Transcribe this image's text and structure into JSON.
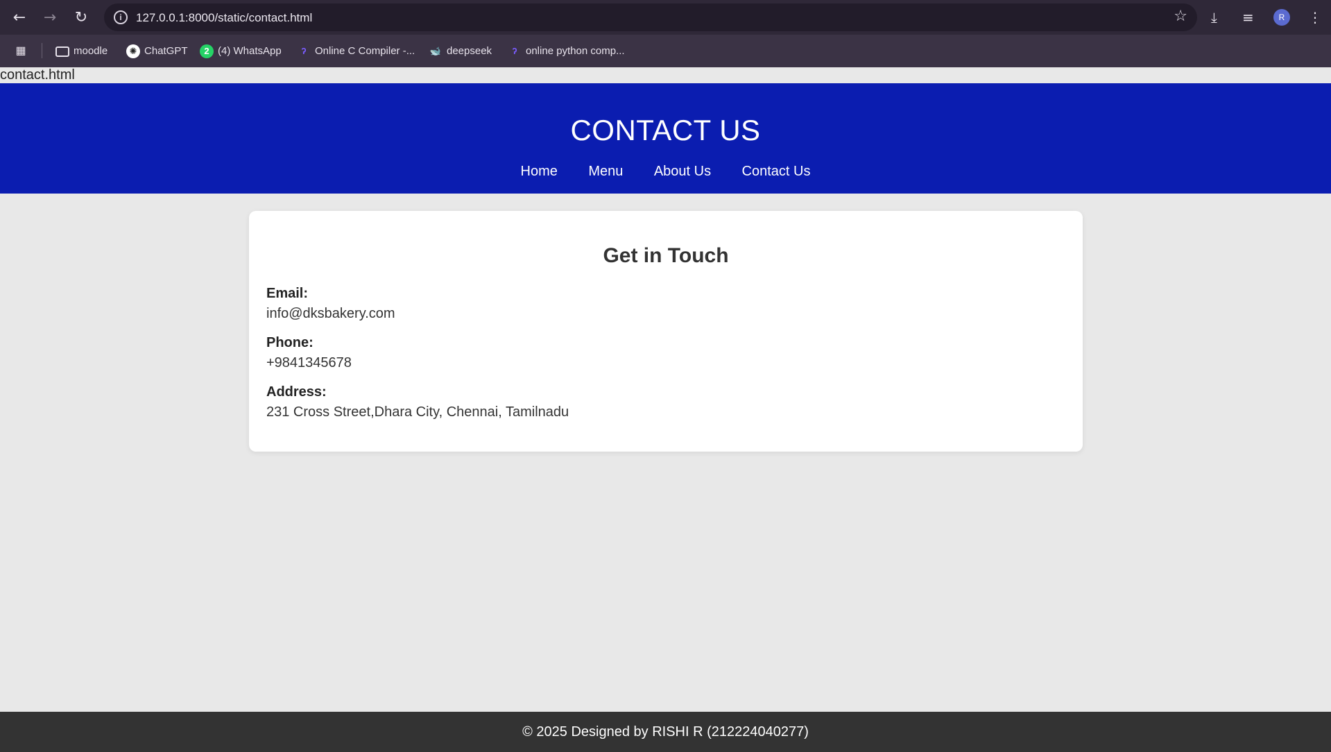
{
  "browser": {
    "url_host": "127.0.0.1",
    "url_rest": ":8000/static/contact.html",
    "avatar_initial": "R",
    "bookmarks": [
      {
        "label": "moodle",
        "icon": "folder-icon"
      },
      {
        "label": "ChatGPT",
        "icon": "chatgpt-icon"
      },
      {
        "label": "(4) WhatsApp",
        "icon": "whatsapp-icon",
        "badge": "2"
      },
      {
        "label": "Online C Compiler -...",
        "icon": "compiler-icon"
      },
      {
        "label": "deepseek",
        "icon": "deepseek-icon"
      },
      {
        "label": "online python comp...",
        "icon": "compiler-icon"
      }
    ]
  },
  "page": {
    "file_label": "contact.html",
    "header": {
      "title": "CONTACT US",
      "nav": [
        "Home",
        "Menu",
        "About Us",
        "Contact Us"
      ]
    },
    "card": {
      "heading": "Get in Touch",
      "email_label": "Email:",
      "email_value": "info@dksbakery.com",
      "phone_label": "Phone:",
      "phone_value": "+9841345678",
      "address_label": "Address:",
      "address_value": "231 Cross Street,Dhara City, Chennai, Tamilnadu"
    },
    "footer": "© 2025 Designed by RISHI R (212224040277)"
  },
  "colors": {
    "header_bg": "#0b1db0",
    "footer_bg": "#333333",
    "page_bg": "#e8e8e8"
  }
}
